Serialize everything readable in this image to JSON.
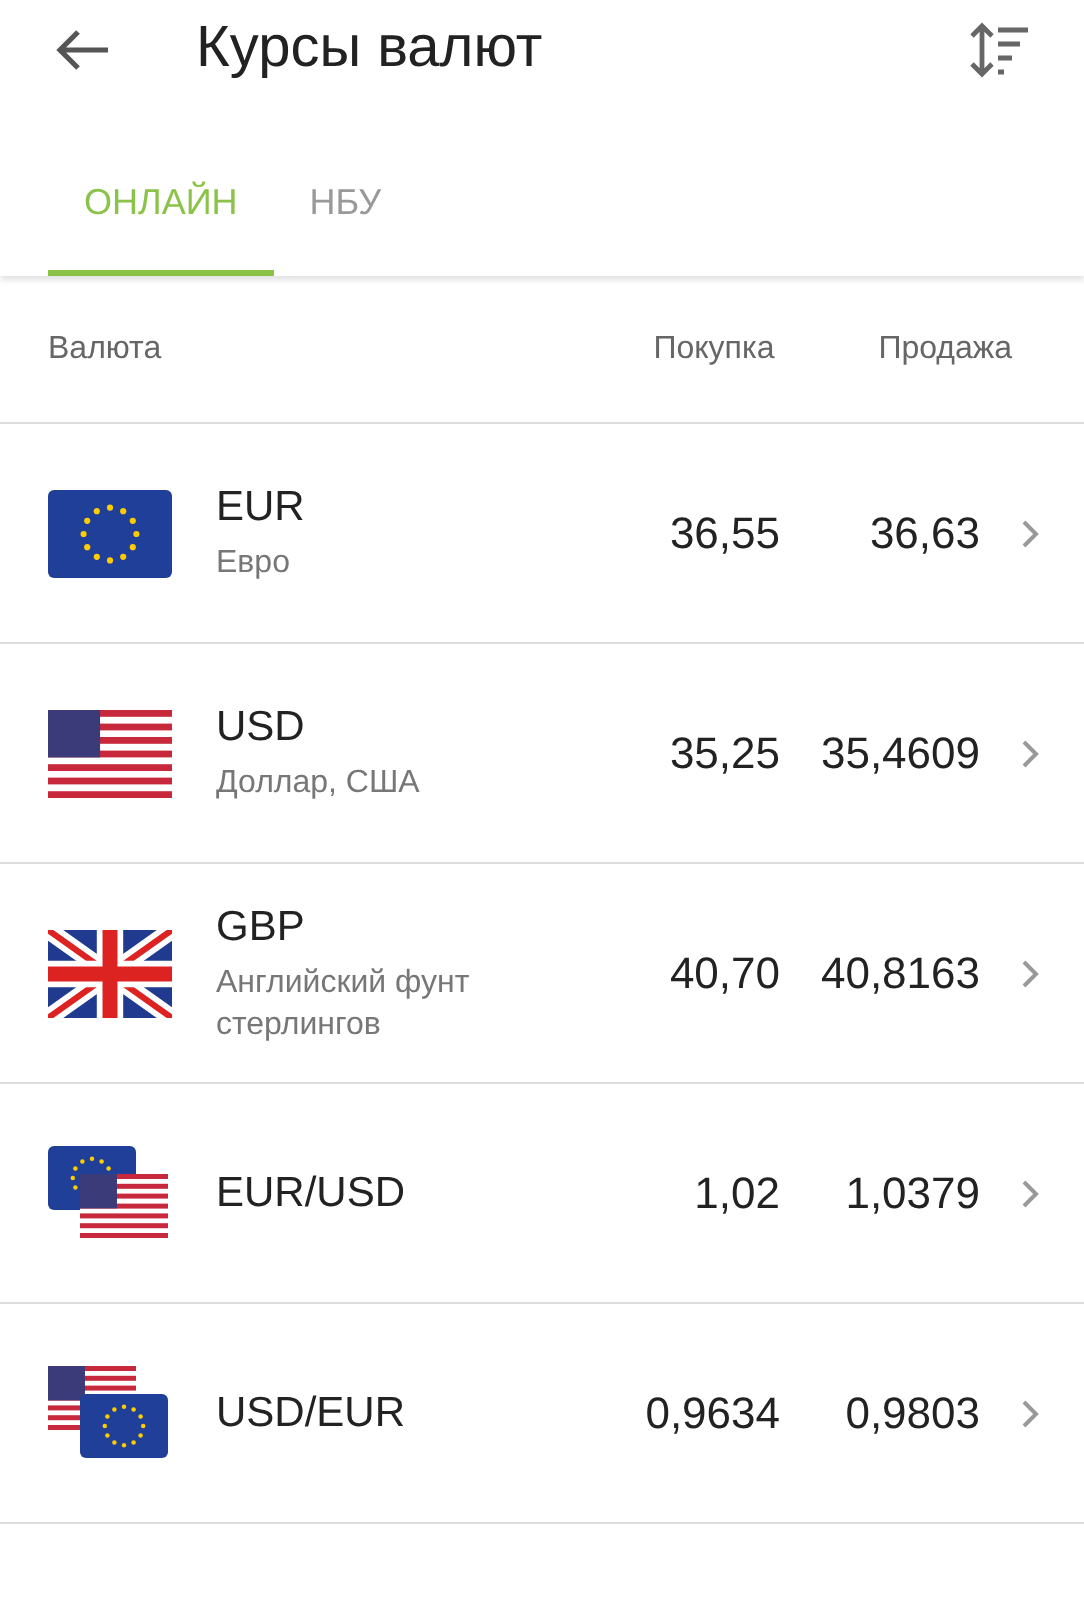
{
  "header": {
    "title": "Курсы валют"
  },
  "tabs": [
    {
      "label": "ОНЛАЙН",
      "selected": true
    },
    {
      "label": "НБУ",
      "selected": false
    }
  ],
  "columns": {
    "currency": "Валюта",
    "buy": "Покупка",
    "sell": "Продажа"
  },
  "rows": [
    {
      "flags": [
        {
          "kind": "eu"
        }
      ],
      "code": "EUR",
      "name": "Евро",
      "buy": "36,55",
      "sell": "36,63"
    },
    {
      "flags": [
        {
          "kind": "us"
        }
      ],
      "code": "USD",
      "name": "Доллар, США",
      "buy": "35,25",
      "sell": "35,4609"
    },
    {
      "flags": [
        {
          "kind": "gb"
        }
      ],
      "code": "GBP",
      "name": "Английский фунт стерлингов",
      "buy": "40,70",
      "sell": "40,8163"
    },
    {
      "flags": [
        {
          "kind": "eu"
        },
        {
          "kind": "us"
        }
      ],
      "code": "EUR/USD",
      "buy": "1,02",
      "sell": "1,0379"
    },
    {
      "flags": [
        {
          "kind": "us"
        },
        {
          "kind": "eu"
        }
      ],
      "code": "USD/EUR",
      "buy": "0,9634",
      "sell": "0,9803"
    }
  ]
}
